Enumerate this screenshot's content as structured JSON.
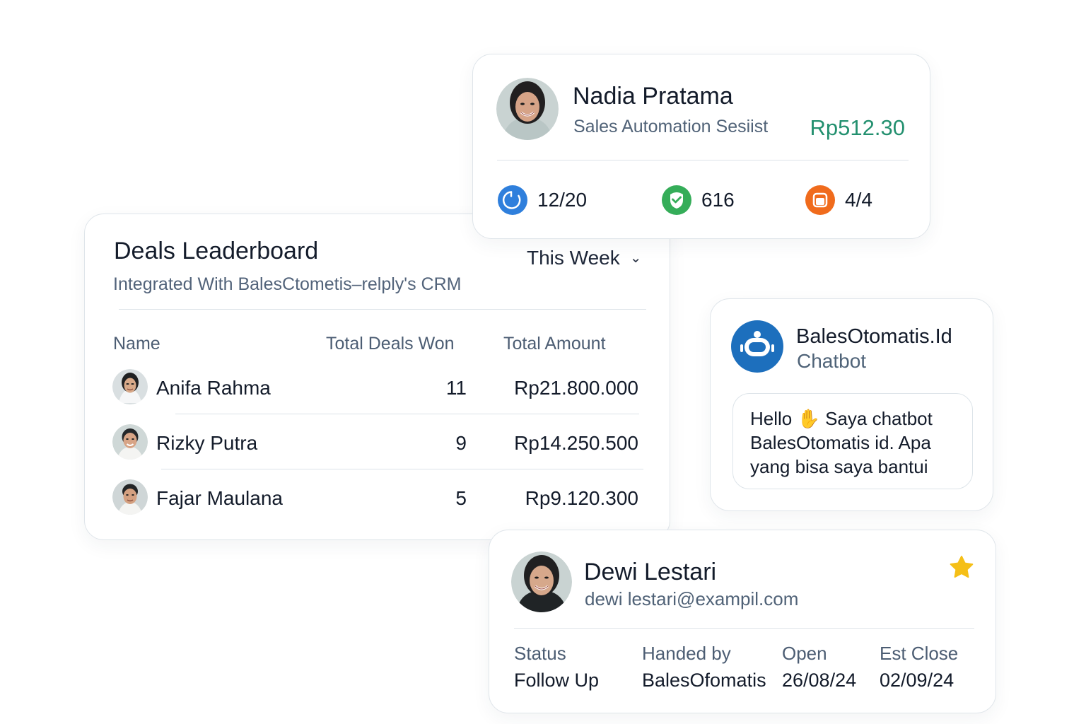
{
  "profile_card": {
    "name": "Nadia Pratama",
    "role": "Sales Automation Sesiist",
    "amount": "Rp512.30",
    "stats": [
      {
        "icon": "progress-ring-icon",
        "value": "12/20",
        "color": "#2f7fdc"
      },
      {
        "icon": "shield-check-icon",
        "value": "616",
        "color": "#35ad59"
      },
      {
        "icon": "box-icon",
        "value": "4/4",
        "color": "#f06b1c"
      }
    ]
  },
  "leaderboard": {
    "title": "Deals Leaderboard",
    "subtitle": "Integrated With BalesCtometis–relply's CRM",
    "period": "This Week",
    "columns": [
      "Name",
      "Total Deals Won",
      "Total Amount"
    ],
    "rows": [
      {
        "name": "Anifa Rahma",
        "deals": "11",
        "amount": "Rp21.800.000"
      },
      {
        "name": "Rizky Putra",
        "deals": "9",
        "amount": "Rp14.250.500"
      },
      {
        "name": "Fajar Maulana",
        "deals": "5",
        "amount": "Rp9.120.300"
      }
    ]
  },
  "chatbot": {
    "name": "BalesOtomatis.Id",
    "subtitle": "Chatbot",
    "message_before": "Hello",
    "message_after": "Saya chatbot BalesOtomatis id. Apa yang bisa saya bantui",
    "icon": "robot-icon",
    "accent": "#1d6fbd"
  },
  "contact_card": {
    "name": "Dewi Lestari",
    "email": "dewi lestari@exampil.com",
    "starred": true,
    "fields": [
      {
        "label": "Status",
        "value": "Follow Up"
      },
      {
        "label": "Handed by",
        "value": "BalesOfomatis"
      },
      {
        "label": "Open",
        "value": "26/08/24"
      },
      {
        "label": "Est Close",
        "value": "02/09/24"
      }
    ]
  }
}
